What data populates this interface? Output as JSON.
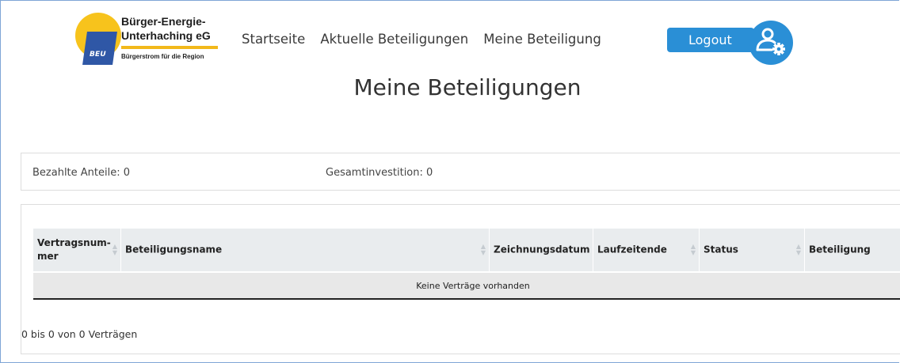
{
  "logo": {
    "badge": "BEU",
    "name_line1": "Bürger-Energie-",
    "name_line2": "Unterhaching eG",
    "slogan": "Bürgerstrom für die Region"
  },
  "nav": {
    "items": [
      {
        "label": "Startseite"
      },
      {
        "label": "Aktuelle Beteiligungen"
      },
      {
        "label": "Meine Beteiligung"
      }
    ],
    "logout_label": "Logout",
    "user_settings_icon": "user-gear-icon"
  },
  "page": {
    "title": "Meine Beteiligungen"
  },
  "summary": {
    "paid_shares_label": "Bezahlte Anteile:",
    "paid_shares_value": "0",
    "total_investment_label": "Gesamtinvestition:",
    "total_investment_value": "0"
  },
  "table": {
    "columns": [
      {
        "label": "Vertragsnum-\nmer"
      },
      {
        "label": "Beteiligungsname"
      },
      {
        "label": "Zeichnungsdatum"
      },
      {
        "label": "Laufzeitende"
      },
      {
        "label": "Status"
      },
      {
        "label": "Beteiligung"
      }
    ],
    "empty_message": "Keine Verträge vorhanden",
    "info": "0 bis 0 von 0 Verträgen"
  },
  "colors": {
    "accent": "#2a8fd6",
    "logo_yellow": "#f7c31c",
    "logo_blue": "#2f57a6",
    "header_bg": "#e9ecee"
  }
}
